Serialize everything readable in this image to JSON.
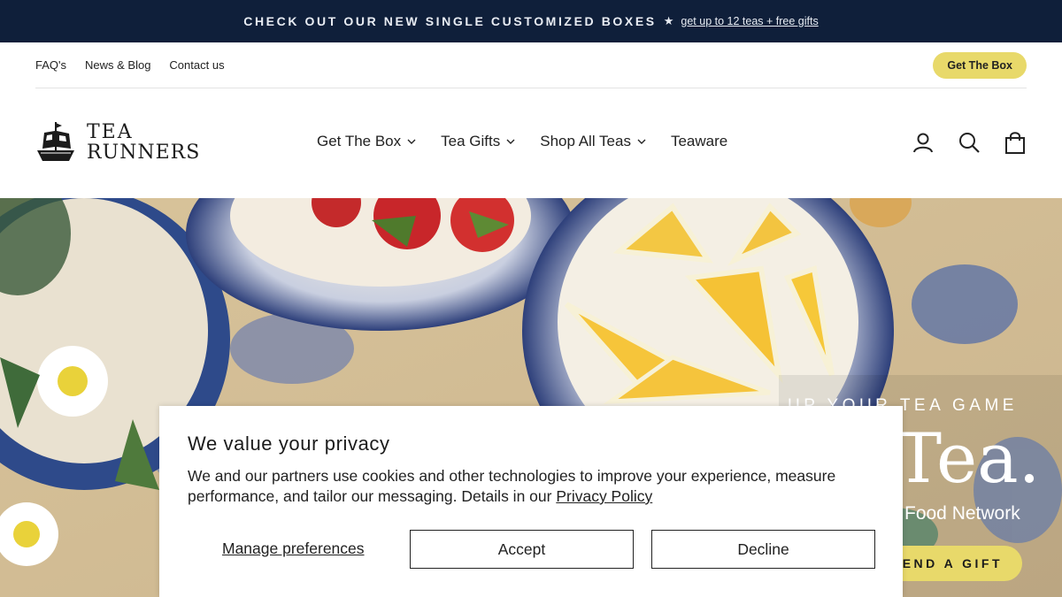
{
  "announcement": {
    "message": "CHECK OUT OUR NEW SINGLE CUSTOMIZED BOXES",
    "star": "★",
    "link": "get up to 12 teas + free gifts"
  },
  "utility_nav": {
    "links": [
      "FAQ's",
      "News & Blog",
      "Contact us"
    ],
    "cta": "Get The Box"
  },
  "header": {
    "logo_line1": "TEA",
    "logo_line2": "RUNNERS",
    "nav": [
      {
        "label": "Get The Box",
        "has_dropdown": true
      },
      {
        "label": "Tea Gifts",
        "has_dropdown": true
      },
      {
        "label": "Shop All Teas",
        "has_dropdown": true
      },
      {
        "label": "Teaware",
        "has_dropdown": false
      }
    ],
    "icons": [
      "account-icon",
      "search-icon",
      "cart-icon"
    ]
  },
  "hero": {
    "eyebrow": "UP YOUR TEA GAME",
    "headline": "Tea.",
    "subtitle": "Food Network",
    "button": "SEND A GIFT"
  },
  "consent": {
    "title": "We value your privacy",
    "body": "We and our partners use cookies and other technologies to improve your experience, measure performance, and tailor our messaging. Details in our ",
    "policy_link": "Privacy Policy",
    "manage": "Manage preferences",
    "accept": "Accept",
    "decline": "Decline"
  },
  "colors": {
    "announce_bg": "#0f1f3a",
    "accent_yellow": "#e8d96a"
  }
}
